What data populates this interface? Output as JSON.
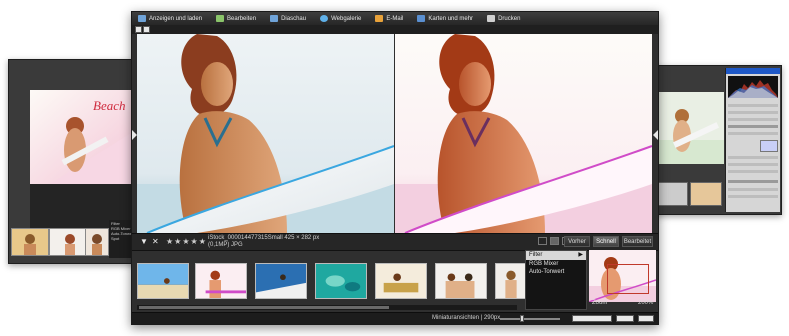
{
  "menu": {
    "items": [
      {
        "label": "Anzeigen und laden",
        "icon": "view-load-icon",
        "color": "#6fa3d8"
      },
      {
        "label": "Bearbeiten",
        "icon": "edit-icon",
        "color": "#8ac46a"
      },
      {
        "label": "Diaschau",
        "icon": "slideshow-icon",
        "color": "#6fa3d8"
      },
      {
        "label": "Webgalerie",
        "icon": "web-gallery-icon",
        "color": "#5fb0e8"
      },
      {
        "label": "E-Mail",
        "icon": "email-icon",
        "color": "#e8a23a"
      },
      {
        "label": "Karten und mehr",
        "icon": "cards-icon",
        "color": "#5a8fd0"
      },
      {
        "label": "Drucken",
        "icon": "printer-icon",
        "color": "#cfcfcf"
      }
    ]
  },
  "info": {
    "stars": "★★★★★",
    "file_line1": "iStock_000014477315Small   425 × 282 px",
    "file_line2": "(0,1MP)   JPG"
  },
  "modes": {
    "vorher": "Vorher",
    "schnell": "Schnell",
    "bearbeitet": "Bearbeitet"
  },
  "filter": {
    "title": "Filter",
    "options": [
      "RGB Mixer",
      "Auto-Tonwert"
    ]
  },
  "navigator": {
    "zoom_label": "Zoom",
    "zoom_value": "200%"
  },
  "status": {
    "thumb_size": "Miniaturansichten  |  290px"
  },
  "left_window": {
    "title_text": "Beach",
    "filter_title": "Filter",
    "filter_options": [
      "RGB Mixer",
      "Auto-Tonwert",
      "Spot"
    ]
  },
  "colors": {
    "accent_blue": "#1e58c7",
    "window_dark": "#2f2f2f",
    "nav_frame": "#c0392b"
  }
}
